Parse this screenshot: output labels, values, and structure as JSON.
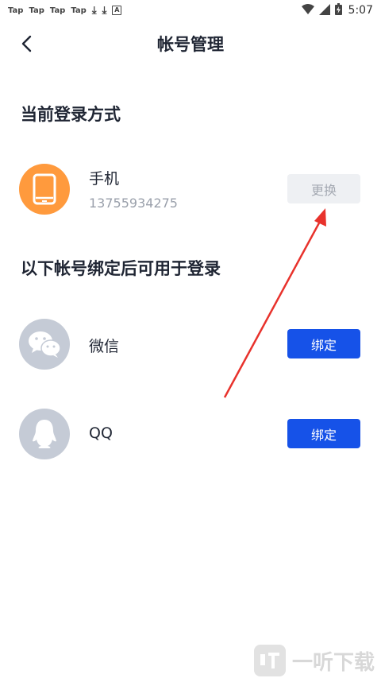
{
  "status_bar": {
    "tap_labels": [
      "Tap",
      "Tap",
      "Tap",
      "Tap"
    ],
    "a_label": "A",
    "time": "5:07"
  },
  "header": {
    "title": "帐号管理"
  },
  "current_login": {
    "section_title": "当前登录方式",
    "method_label": "手机",
    "phone": "13755934275",
    "change_button": "更换"
  },
  "bind_section": {
    "section_title": "以下帐号绑定后可用于登录",
    "items": [
      {
        "label": "微信",
        "button": "绑定"
      },
      {
        "label": "QQ",
        "button": "绑定"
      }
    ]
  },
  "watermark": {
    "text": "一听下载"
  },
  "colors": {
    "primary": "#1652e8",
    "phone_avatar": "#ff9a3d",
    "grey_avatar": "#c5cbd6",
    "annotation_arrow": "#e8322c"
  }
}
